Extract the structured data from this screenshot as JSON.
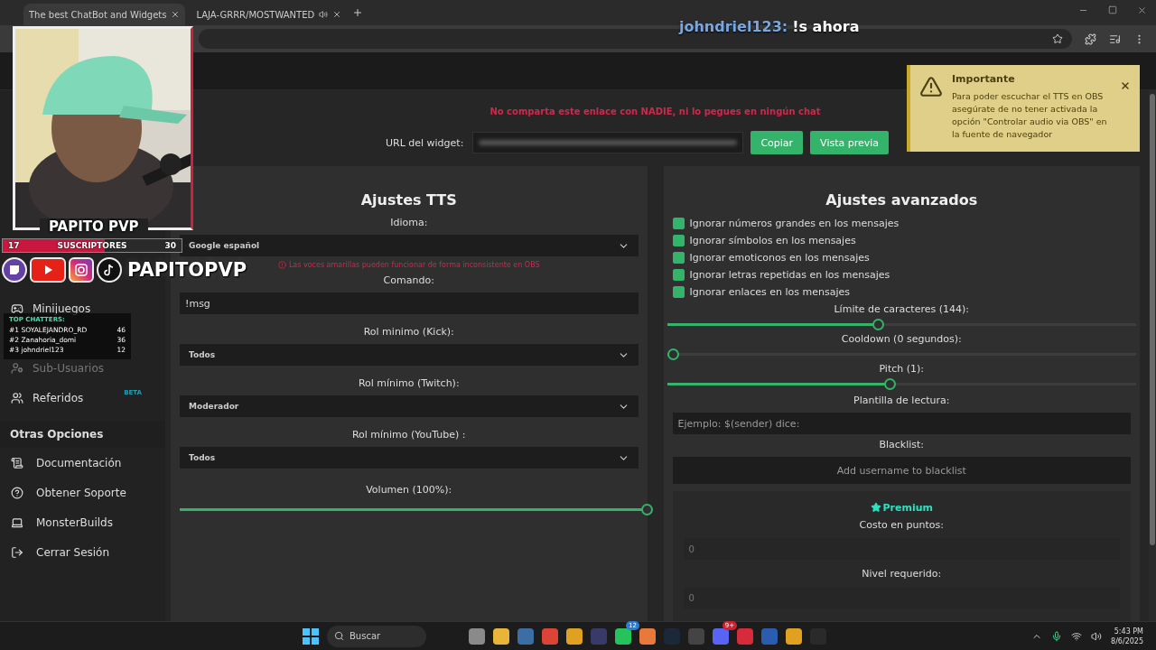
{
  "browser": {
    "tabs": [
      {
        "title": "The best ChatBot and Widgets",
        "selected": true
      },
      {
        "title": "LAJA-GRRR/MOSTWANTED",
        "selected": false
      }
    ]
  },
  "sidebar": {
    "items": [
      {
        "label": "Minijuegos",
        "disabled": false
      },
      {
        "label": "Sub-Usuarios",
        "disabled": true
      },
      {
        "label": "Referidos",
        "disabled": false,
        "badge": "BETA",
        "color": "#17a2b8"
      }
    ],
    "section": {
      "heading": "Otras Opciones",
      "items": [
        {
          "label": "Documentación",
          "disabled": false
        },
        {
          "label": "Obtener Soporte",
          "disabled": false
        },
        {
          "label": "MonsterBuilds",
          "disabled": false
        },
        {
          "label": "Cerrar Sesión",
          "disabled": false
        }
      ]
    }
  },
  "notice": "No comparta este enlace con NADIE, ni lo pegues en ningún chat",
  "widget_url": {
    "label": "URL del widget:",
    "buttons": [
      "Copiar",
      "Vista previa"
    ]
  },
  "tts": {
    "title": "Ajustes TTS",
    "fields": [
      {
        "kind": "select",
        "label": "Idioma:",
        "value": "Google español",
        "hint": "Las voces amarillas pueden funcionar de forma inconsistente en OBS"
      },
      {
        "kind": "input",
        "label": "Comando:",
        "value": "!msg"
      },
      {
        "kind": "select",
        "label": "Rol minimo (Kick):",
        "value": "Todos"
      },
      {
        "kind": "select",
        "label": "Rol mínimo (Twitch):",
        "value": "Moderador"
      },
      {
        "kind": "select",
        "label": "Rol mínimo (YouTube) :",
        "value": "Todos"
      },
      {
        "kind": "slider",
        "label": "Volumen (100%):",
        "level": 1
      }
    ]
  },
  "advanced": {
    "title": "Ajustes avanzados",
    "options": [
      {
        "label": "Ignorar números grandes en los mensajes",
        "checked": true
      },
      {
        "label": "Ignorar símbolos en los mensajes",
        "checked": true
      },
      {
        "label": "Ignorar emoticonos en los mensajes",
        "checked": true
      },
      {
        "label": "Ignorar letras repetidas en los mensajes",
        "checked": true
      },
      {
        "label": "Ignorar enlaces en los mensajes",
        "checked": true
      }
    ],
    "fields": [
      {
        "kind": "slider",
        "label": "Límite de caracteres (144):",
        "level": 0.45
      },
      {
        "kind": "slider",
        "label": "Cooldown (0 segundos):",
        "level": 0
      },
      {
        "kind": "slider",
        "label": "Pitch (1):",
        "level": 0.475
      },
      {
        "kind": "input",
        "label": "Plantilla de lectura:",
        "placeholder": "Ejemplo: $(sender) dice:"
      },
      {
        "kind": "tags",
        "label": "Blacklist:",
        "placeholder": "Add username to blacklist"
      }
    ],
    "premium": {
      "title": "Premium",
      "fields": [
        {
          "label": "Costo en puntos:",
          "placeholder": "0"
        },
        {
          "label": "Nivel requerido:",
          "placeholder": "0"
        }
      ]
    }
  },
  "toast": {
    "title": "Importante",
    "message": "Para poder escuchar el TTS en OBS asegúrate de no tener activada la opción \"Controlar audio via OBS\" en la fuente de navegador"
  },
  "overlay": {
    "chat": {
      "user": "johndriel123:",
      "message": "!s ahora"
    },
    "camera": {
      "kind": "picture",
      "name": "PAPITO PVP"
    },
    "subs": {
      "current": "17",
      "label": "SUSCRIPTORES",
      "goal": "30",
      "level": 0.57
    },
    "handle": "PAPITOPVP",
    "top_chatters": {
      "title": "TOP CHATTERS:",
      "rows": [
        {
          "rank": "#1",
          "name": "SOYALEJANDRO_RD",
          "count": "46"
        },
        {
          "rank": "#2",
          "name": "Zanahoria_domi",
          "count": "36"
        },
        {
          "rank": "#3",
          "name": "johndriel123",
          "count": "12"
        }
      ]
    }
  },
  "taskbar": {
    "search": "Buscar",
    "badges": [
      "12",
      "9+"
    ],
    "time": "5:43 PM",
    "date": "8/6/2025"
  }
}
